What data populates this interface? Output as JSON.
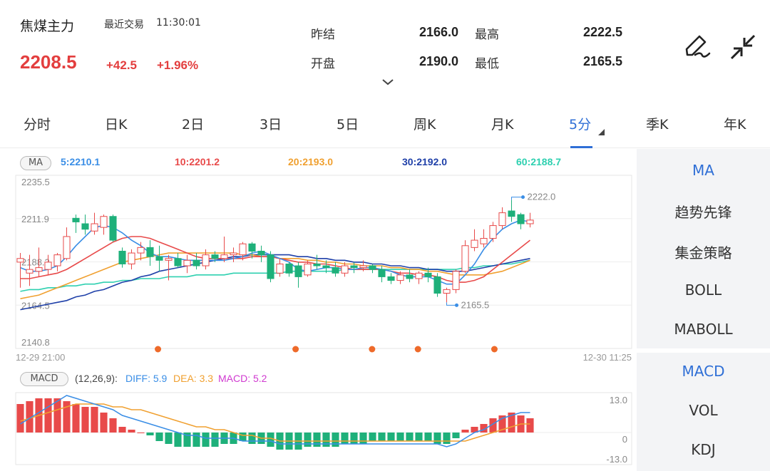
{
  "header": {
    "title": "焦煤主力",
    "recent_label": "最近交易",
    "time": "11:30:01",
    "price": "2208.5",
    "change": "+42.5",
    "change_pct": "+1.96%",
    "quote": {
      "prev_close_label": "昨结",
      "prev_close": "2166.0",
      "high_label": "最高",
      "high": "2222.5",
      "open_label": "开盘",
      "open": "2190.0",
      "low_label": "最低",
      "low": "2165.5"
    },
    "icons": [
      "draw-pen-icon",
      "collapse-arrows-icon",
      "chevron-down-icon"
    ]
  },
  "tabs": [
    {
      "label": "分时"
    },
    {
      "label": "日K"
    },
    {
      "label": "2日"
    },
    {
      "label": "3日"
    },
    {
      "label": "5日"
    },
    {
      "label": "周K"
    },
    {
      "label": "月K"
    },
    {
      "label": "5分",
      "active": true
    },
    {
      "label": "季K"
    },
    {
      "label": "年K"
    }
  ],
  "ma": {
    "badge": "MA",
    "items": [
      {
        "text": "5:2210.1",
        "color": "#3a8ee6"
      },
      {
        "text": "10:2201.2",
        "color": "#e84a4a"
      },
      {
        "text": "20:2193.0",
        "color": "#f0a030"
      },
      {
        "text": "30:2192.0",
        "color": "#1e3fa8"
      },
      {
        "text": "60:2188.7",
        "color": "#2ed0b0"
      }
    ]
  },
  "price_axis": [
    "2235.5",
    "2211.9",
    "2188.2",
    "2164.5",
    "2140.8"
  ],
  "time_axis": {
    "start": "12-29 21:00",
    "end": "12-30 11:25"
  },
  "annotations": {
    "high": "2222.0",
    "low": "2165.5"
  },
  "macd": {
    "badge": "MACD",
    "params": "(12,26,9):",
    "diff": "DIFF: 5.9",
    "dea": "DEA: 3.3",
    "macd": "MACD: 5.2",
    "axis": [
      "13.0",
      "0",
      "-13.0"
    ]
  },
  "side_panel": {
    "main": [
      "MA",
      "趋势先锋",
      "集金策略",
      "BOLL",
      "MABOLL"
    ],
    "sub": [
      "MACD",
      "VOL",
      "KDJ"
    ]
  },
  "colors": {
    "up": "#e84a4a",
    "down": "#1eb07a",
    "accent": "#2f6fd6",
    "ma5": "#3a8ee6",
    "ma10": "#e84a4a",
    "ma20": "#f0a030",
    "ma30": "#1e3fa8",
    "ma60": "#2ed0b0",
    "dea": "#f0a030",
    "diff": "#3a8ee6",
    "signal_dot": "#ee6a2a"
  },
  "chart_data": {
    "type": "candlestick",
    "ylim": [
      2140.8,
      2235.5
    ],
    "candles": [
      [
        2188,
        2190,
        2174,
        2193
      ],
      [
        2182,
        2184,
        2175,
        2192
      ],
      [
        2183,
        2185,
        2180,
        2196
      ],
      [
        2184,
        2188,
        2181,
        2192
      ],
      [
        2186,
        2192,
        2183,
        2193
      ],
      [
        2190,
        2202,
        2189,
        2207
      ],
      [
        2212,
        2210,
        2204,
        2214
      ],
      [
        2209,
        2206,
        2203,
        2214
      ],
      [
        2205,
        2209,
        2203,
        2215
      ],
      [
        2207,
        2213,
        2203,
        2214
      ],
      [
        2213,
        2200,
        2199,
        2214
      ],
      [
        2194,
        2187,
        2185,
        2196
      ],
      [
        2187,
        2193,
        2184,
        2195
      ],
      [
        2193,
        2196,
        2189,
        2199
      ],
      [
        2196,
        2191,
        2186,
        2200
      ],
      [
        2191,
        2189,
        2183,
        2197
      ],
      [
        2189,
        2190,
        2178,
        2192
      ],
      [
        2190,
        2186,
        2185,
        2193
      ],
      [
        2186,
        2189,
        2182,
        2192
      ],
      [
        2189,
        2186,
        2184,
        2193
      ],
      [
        2186,
        2192,
        2184,
        2195
      ],
      [
        2192,
        2190,
        2188,
        2194
      ],
      [
        2190,
        2192,
        2188,
        2202
      ],
      [
        2192,
        2193,
        2188,
        2196
      ],
      [
        2192,
        2198,
        2189,
        2199
      ],
      [
        2198,
        2194,
        2190,
        2199
      ],
      [
        2194,
        2192,
        2188,
        2197
      ],
      [
        2192,
        2179,
        2177,
        2194
      ],
      [
        2182,
        2187,
        2180,
        2190
      ],
      [
        2187,
        2182,
        2180,
        2188
      ],
      [
        2186,
        2180,
        2174,
        2188
      ],
      [
        2181,
        2187,
        2180,
        2189
      ],
      [
        2187,
        2186,
        2184,
        2192
      ],
      [
        2186,
        2185,
        2182,
        2189
      ],
      [
        2185,
        2182,
        2180,
        2188
      ],
      [
        2182,
        2186,
        2180,
        2188
      ],
      [
        2186,
        2185,
        2182,
        2188
      ],
      [
        2185,
        2186,
        2183,
        2189
      ],
      [
        2186,
        2184,
        2182,
        2187
      ],
      [
        2184,
        2180,
        2177,
        2186
      ],
      [
        2180,
        2178,
        2176,
        2182
      ],
      [
        2178,
        2181,
        2176,
        2183
      ],
      [
        2181,
        2179,
        2177,
        2184
      ],
      [
        2179,
        2182,
        2176,
        2183
      ],
      [
        2182,
        2180,
        2177,
        2185
      ],
      [
        2180,
        2171,
        2169,
        2182
      ],
      [
        2171,
        2173,
        2166,
        2174
      ],
      [
        2173,
        2183,
        2171,
        2184
      ],
      [
        2183,
        2197,
        2182,
        2200
      ],
      [
        2196,
        2200,
        2194,
        2206
      ],
      [
        2198,
        2201,
        2196,
        2206
      ],
      [
        2201,
        2208,
        2199,
        2210
      ],
      [
        2208,
        2215,
        2206,
        2218
      ],
      [
        2216,
        2213,
        2210,
        2222
      ],
      [
        2214,
        2209,
        2206,
        2215
      ],
      [
        2209,
        2211,
        2207,
        2215
      ]
    ],
    "ma5": [
      2185,
      2183,
      2183,
      2184,
      2186,
      2191,
      2197,
      2202,
      2207,
      2208,
      2207,
      2204,
      2200,
      2197,
      2193,
      2191,
      2191,
      2190,
      2189,
      2189,
      2189,
      2189,
      2189,
      2190,
      2191,
      2193,
      2194,
      2192,
      2190,
      2188,
      2184,
      2183,
      2184,
      2185,
      2185,
      2184,
      2184,
      2185,
      2185,
      2184,
      2183,
      2181,
      2180,
      2180,
      2180,
      2178,
      2176,
      2176,
      2181,
      2187,
      2195,
      2201,
      2206,
      2209,
      2211,
      2210
    ],
    "ma10": [
      2179,
      2179,
      2180,
      2181,
      2182,
      2184,
      2187,
      2190,
      2193,
      2196,
      2199,
      2201,
      2202,
      2202,
      2201,
      2199,
      2197,
      2195,
      2193,
      2191,
      2190,
      2190,
      2190,
      2190,
      2190,
      2191,
      2191,
      2191,
      2190,
      2189,
      2188,
      2188,
      2187,
      2187,
      2186,
      2185,
      2184,
      2184,
      2184,
      2184,
      2183,
      2182,
      2182,
      2181,
      2181,
      2180,
      2178,
      2177,
      2177,
      2178,
      2180,
      2184,
      2188,
      2192,
      2196,
      2200
    ],
    "ma20": [
      2168,
      2169,
      2170,
      2172,
      2174,
      2176,
      2178,
      2180,
      2182,
      2184,
      2186,
      2188,
      2189,
      2190,
      2191,
      2192,
      2193,
      2193,
      2193,
      2193,
      2193,
      2193,
      2193,
      2193,
      2192,
      2192,
      2191,
      2191,
      2190,
      2190,
      2190,
      2189,
      2189,
      2188,
      2188,
      2187,
      2187,
      2186,
      2186,
      2186,
      2185,
      2185,
      2184,
      2184,
      2183,
      2183,
      2182,
      2181,
      2181,
      2181,
      2181,
      2182,
      2183,
      2185,
      2187,
      2189
    ],
    "ma30": [
      2162,
      2163,
      2164,
      2165,
      2166,
      2167,
      2169,
      2170,
      2172,
      2173,
      2175,
      2177,
      2178,
      2180,
      2181,
      2183,
      2184,
      2185,
      2186,
      2187,
      2188,
      2189,
      2190,
      2191,
      2191,
      2192,
      2192,
      2192,
      2192,
      2192,
      2191,
      2191,
      2190,
      2190,
      2189,
      2189,
      2188,
      2188,
      2187,
      2187,
      2186,
      2186,
      2185,
      2185,
      2184,
      2184,
      2183,
      2183,
      2183,
      2184,
      2185,
      2186,
      2187,
      2188,
      2189,
      2190
    ],
    "ma60": [
      2172,
      2173,
      2173,
      2174,
      2174,
      2175,
      2175,
      2176,
      2176,
      2177,
      2177,
      2178,
      2178,
      2179,
      2179,
      2179,
      2180,
      2180,
      2180,
      2181,
      2181,
      2181,
      2181,
      2182,
      2182,
      2182,
      2182,
      2182,
      2182,
      2183,
      2183,
      2183,
      2183,
      2183,
      2183,
      2184,
      2184,
      2184,
      2184,
      2184,
      2184,
      2184,
      2184,
      2184,
      2184,
      2184,
      2184,
      2184,
      2185,
      2185,
      2186,
      2186,
      2187,
      2187,
      2188,
      2189
    ],
    "signal_points": [
      9,
      18,
      23,
      26,
      31
    ],
    "macd_hist": [
      10,
      11,
      12,
      12,
      12,
      11,
      10,
      9,
      9,
      7,
      5,
      2,
      1,
      0,
      -1,
      -3,
      -4,
      -5,
      -5,
      -5,
      -5,
      -5,
      -4,
      -4,
      -3,
      -4,
      -4,
      -5,
      -6,
      -6,
      -6,
      -5,
      -5,
      -5,
      -5,
      -4,
      -4,
      -4,
      -3,
      -3,
      -3,
      -3,
      -3,
      -3,
      -3,
      -4,
      -4,
      -2,
      1,
      2,
      3,
      5,
      6,
      7,
      6,
      5
    ],
    "diff": [
      3,
      5,
      7,
      9,
      11,
      13,
      12,
      11,
      10,
      9,
      8,
      6,
      5,
      4,
      3,
      2,
      1,
      0,
      -1,
      -1,
      -2,
      -2,
      -2,
      -2,
      -3,
      -3,
      -3,
      -3,
      -4,
      -4,
      -4,
      -4,
      -4,
      -4,
      -4,
      -4,
      -4,
      -4,
      -4,
      -4,
      -4,
      -4,
      -4,
      -4,
      -4,
      -4,
      -5,
      -4,
      -2,
      0,
      1,
      3,
      5,
      6,
      7,
      7
    ],
    "dea": [
      4,
      5,
      6,
      7,
      8,
      9,
      10,
      10,
      10,
      10,
      9,
      9,
      8,
      8,
      7,
      6,
      5,
      4,
      3,
      2,
      2,
      1,
      1,
      0,
      -1,
      -1,
      -2,
      -2,
      -3,
      -3,
      -3,
      -3,
      -3,
      -3,
      -3,
      -3,
      -3,
      -3,
      -3,
      -3,
      -3,
      -3,
      -3,
      -3,
      -3,
      -3,
      -3,
      -3,
      -3,
      -2,
      -1,
      0,
      1,
      2,
      3,
      3
    ]
  }
}
